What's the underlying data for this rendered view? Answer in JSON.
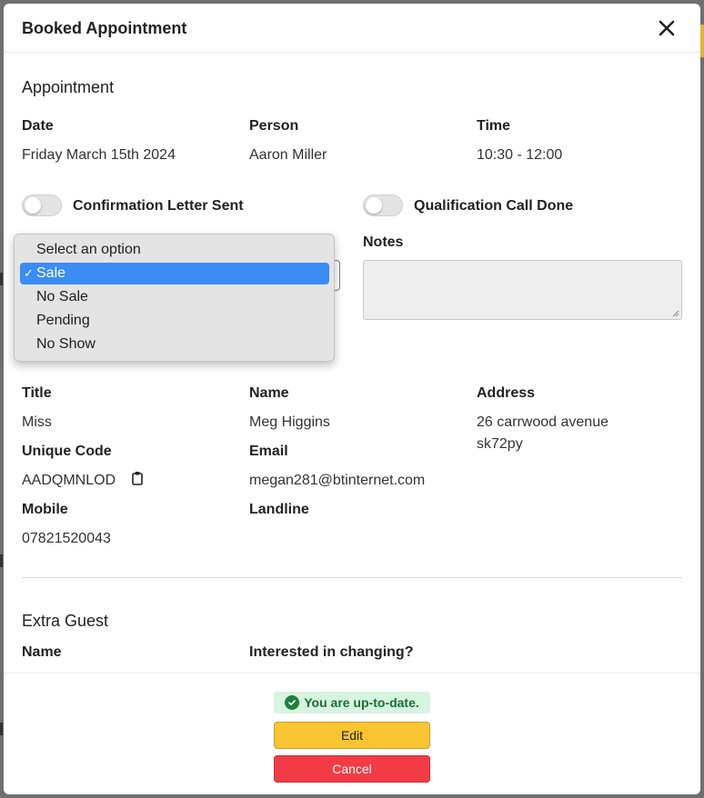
{
  "modal": {
    "title": "Booked Appointment"
  },
  "appointment": {
    "section_title": "Appointment",
    "date_label": "Date",
    "date_value": "Friday March 15th 2024",
    "person_label": "Person",
    "person_value": "Aaron Miller",
    "time_label": "Time",
    "time_value": "10:30 - 12:00",
    "toggle_letter_label": "Confirmation Letter Sent",
    "toggle_letter_on": false,
    "toggle_call_label": "Qualification Call Done",
    "toggle_call_on": false,
    "notes_label": "Notes",
    "notes_value": ""
  },
  "outcome_select": {
    "options": [
      "Select an option",
      "Sale",
      "No Sale",
      "Pending",
      "No Show"
    ],
    "selected": "Sale",
    "check_glyph": "✓"
  },
  "guest": {
    "title_label": "Title",
    "title_value": "Miss",
    "name_label": "Name",
    "name_value": "Meg Higgins",
    "address_label": "Address",
    "address_line1": "26 carrwood avenue",
    "address_line2": "sk72py",
    "code_label": "Unique Code",
    "code_value": "AADQMNLOD",
    "email_label": "Email",
    "email_value": "megan281@btinternet.com",
    "mobile_label": "Mobile",
    "mobile_value": "07821520043",
    "landline_label": "Landline",
    "landline_value": ""
  },
  "extra_guest": {
    "section_title": "Extra Guest",
    "name_label": "Name",
    "interested_label": "Interested in changing?"
  },
  "footer": {
    "status_text": "You are up-to-date.",
    "edit_label": "Edit",
    "cancel_label": "Cancel"
  },
  "colors": {
    "edit": "#f8c531",
    "cancel": "#f23b44",
    "status_bg": "#d6f5df",
    "selected_option": "#3b8cf5"
  }
}
